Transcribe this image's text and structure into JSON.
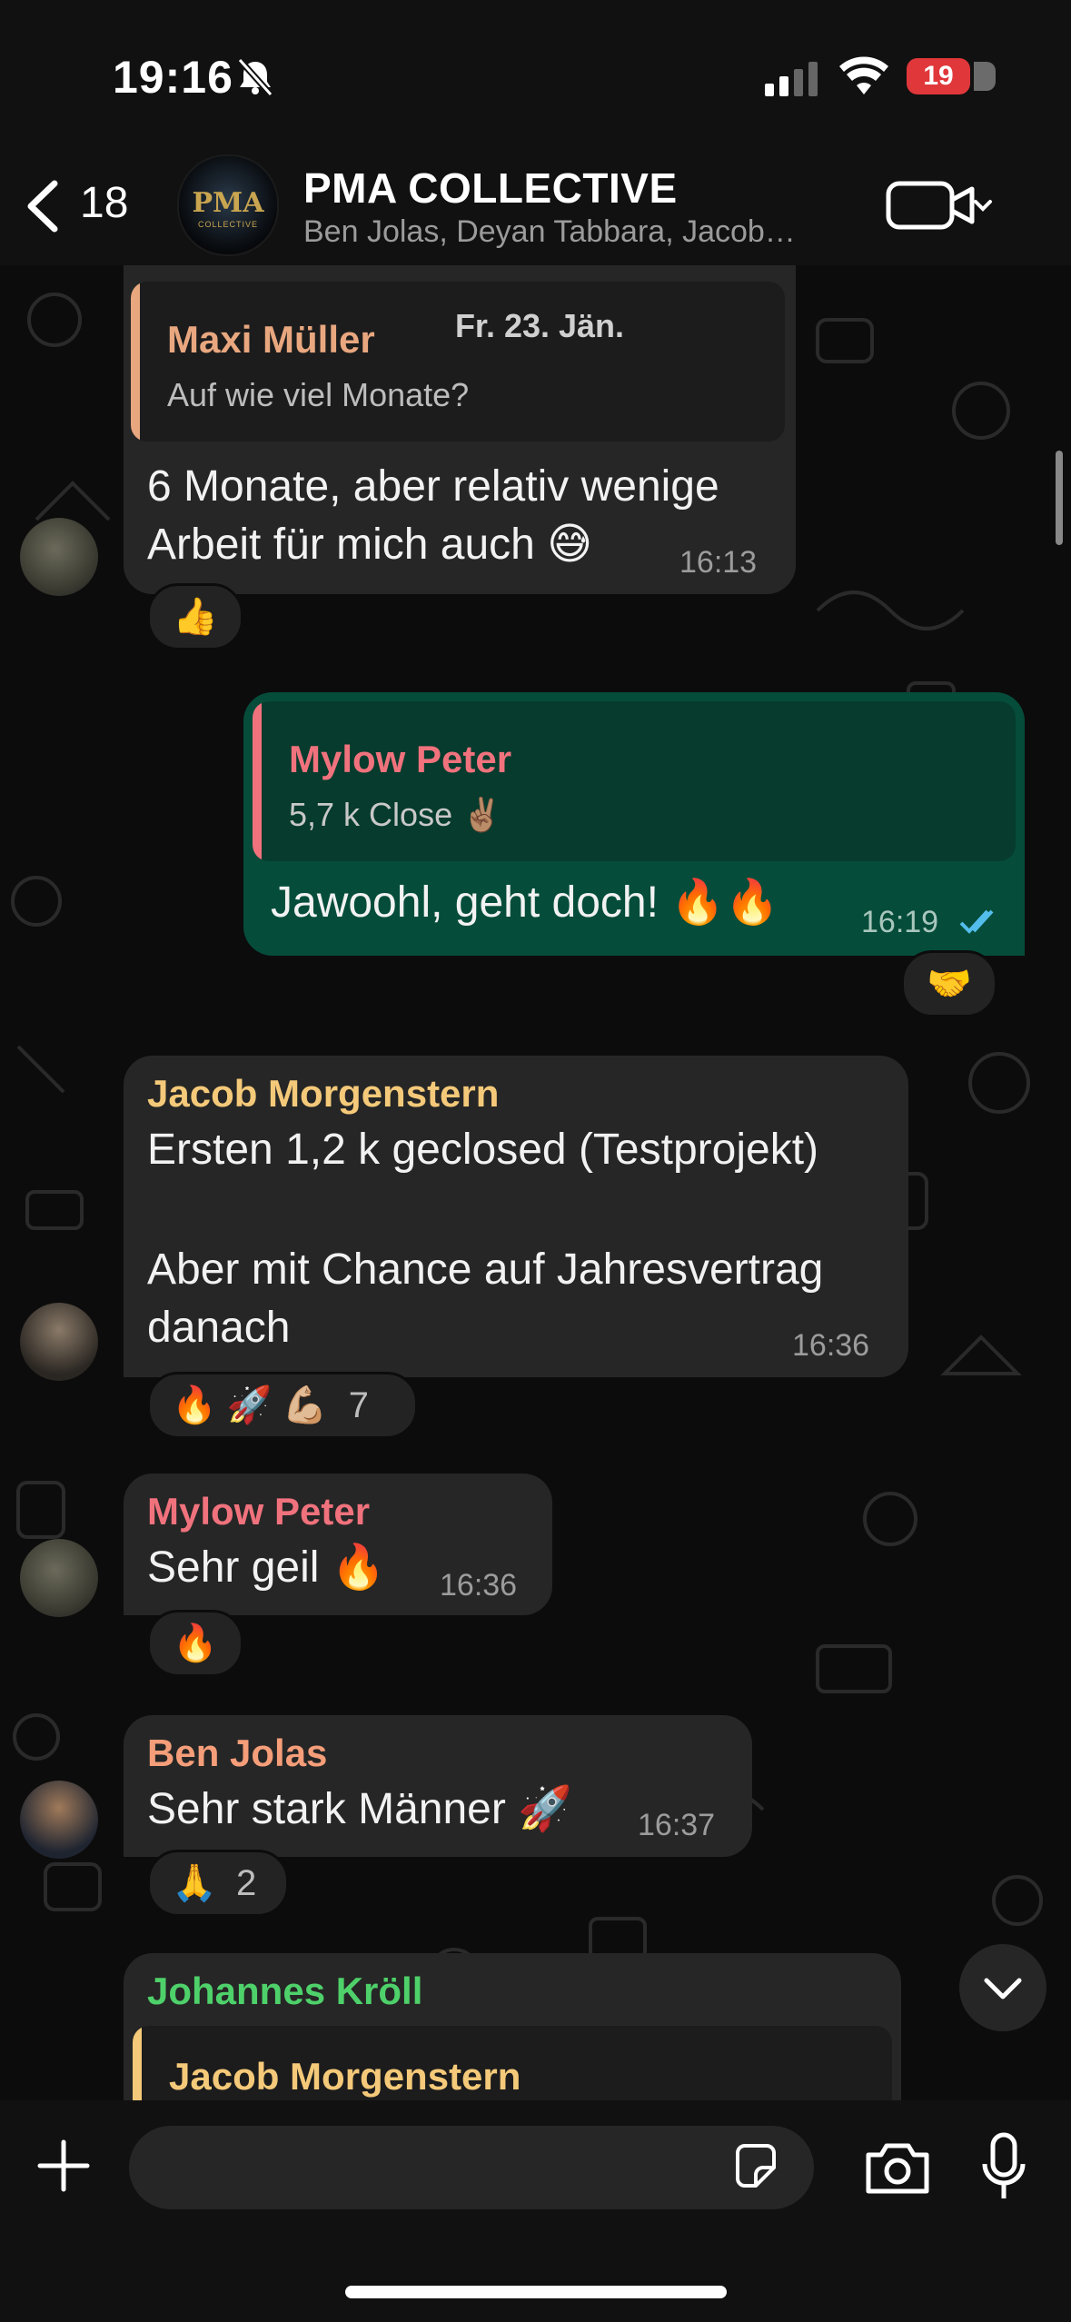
{
  "status_bar": {
    "time": "19:16",
    "battery": "19"
  },
  "header": {
    "back_count": "18",
    "group_name": "PMA COLLECTIVE",
    "members": "Ben Jolas, Deyan Tabbara, Jacob…",
    "avatar_text": "PMA",
    "avatar_sub": "COLLECTIVE"
  },
  "messages": [
    {
      "quote_sender": "Maxi Müller",
      "quote_text": "Auf wie viel Monate?",
      "date_chip": "Fr. 23. Jän.",
      "line1": "6 Monate, aber relativ wenige",
      "line2": "Arbeit für mich auch 😅",
      "time": "16:13",
      "reaction": "👍"
    },
    {
      "quote_sender": "Mylow Peter",
      "quote_text": "5,7 k Close ✌🏽",
      "text": "Jawoohl, geht doch! 🔥🔥",
      "time": "16:19",
      "reaction": "🤝"
    },
    {
      "sender": "Jacob Morgenstern",
      "line1": "Ersten 1,2 k geclosed (Testprojekt)",
      "line2": "Aber mit Chance auf Jahresvertrag",
      "line3": "danach",
      "time": "16:36",
      "reaction": "🔥 🚀 💪🏼",
      "reaction_count": "7"
    },
    {
      "sender": "Mylow Peter",
      "text": "Sehr geil 🔥",
      "time": "16:36",
      "reaction": "🔥"
    },
    {
      "sender": "Ben Jolas",
      "text": "Sehr stark Männer 🚀",
      "time": "16:37",
      "reaction": "🙏",
      "reaction_count": "2"
    },
    {
      "sender": "Johannes Kröll",
      "quote_sender": "Jacob Morgenstern"
    }
  ],
  "colors": {
    "maxi": "#e8a77f",
    "mylow": "#f0727d",
    "jacob": "#f4c979",
    "ben": "#f59e79",
    "johannes": "#4ed16a",
    "outgoing": "#054d3a",
    "read_ticks": "#53bdeb"
  }
}
